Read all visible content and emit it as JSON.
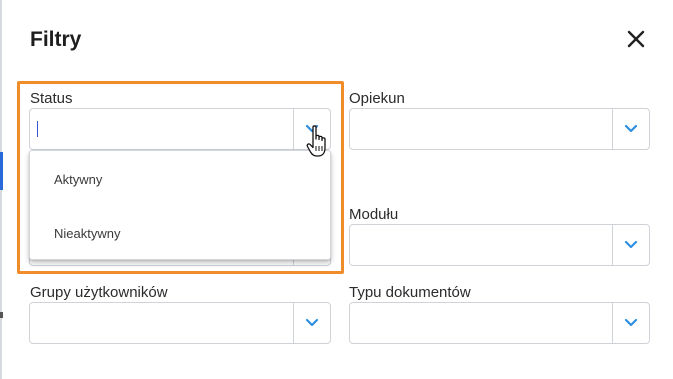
{
  "dialog": {
    "title": "Filtry"
  },
  "fields": {
    "status": {
      "label": "Status",
      "value": ""
    },
    "opiekun": {
      "label": "Opiekun",
      "value": ""
    },
    "modulu": {
      "label": "Modułu",
      "value": ""
    },
    "grupy": {
      "label": "Grupy użytkowników",
      "value": ""
    },
    "typu": {
      "label": "Typu dokumentów",
      "value": ""
    }
  },
  "status_dropdown": {
    "options": [
      "Aktywny",
      "Nieaktywny"
    ]
  },
  "colors": {
    "accent_chevron": "#2f8fe0",
    "highlight_border": "#f08c2a",
    "text_caret": "#3b55d9",
    "field_border": "#cfd3d8"
  },
  "icons": {
    "close": "close-icon",
    "chevron": "chevron-down-icon",
    "cursor": "hand-pointer-icon"
  }
}
